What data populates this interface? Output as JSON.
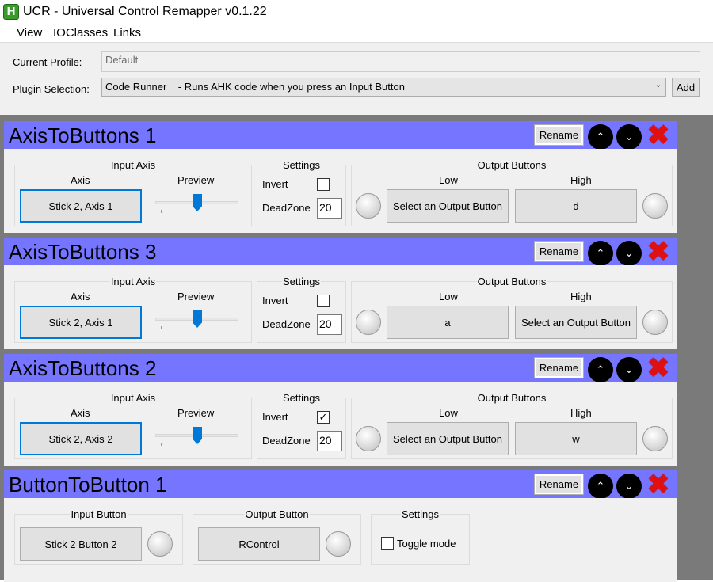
{
  "window": {
    "title": "UCR - Universal Control Remapper v0.1.22",
    "icon": "H"
  },
  "menu": [
    "View",
    "IOClasses",
    "Links"
  ],
  "profile": {
    "label": "Current Profile:",
    "value": "Default"
  },
  "plugin_selection": {
    "label": "Plugin Selection:",
    "value": "Code Runner    - Runs AHK code when you press an Input Button",
    "add_label": "Add"
  },
  "common": {
    "rename": "Rename",
    "input_axis": "Input Axis",
    "axis": "Axis",
    "preview": "Preview",
    "settings": "Settings",
    "invert": "Invert",
    "deadzone": "DeadZone",
    "output_buttons": "Output Buttons",
    "low": "Low",
    "high": "High",
    "input_button": "Input Button",
    "output_button": "Output Button",
    "toggle_mode": "Toggle mode"
  },
  "axis_panels": [
    {
      "title": "AxisToButtons 1",
      "axis": "Stick 2, Axis 1",
      "invert": false,
      "deadzone": "20",
      "low": "Select an Output Button",
      "high": "d",
      "preview": 0.5
    },
    {
      "title": "AxisToButtons 3",
      "axis": "Stick 2, Axis 1",
      "invert": false,
      "deadzone": "20",
      "low": "a",
      "high": "Select an Output Button",
      "preview": 0.5
    },
    {
      "title": "AxisToButtons 2",
      "axis": "Stick 2, Axis 2",
      "invert": true,
      "deadzone": "20",
      "low": "Select an Output Button",
      "high": "w",
      "preview": 0.5
    }
  ],
  "button_panel": {
    "title": "ButtonToButton 1",
    "input": "Stick 2 Button 2",
    "output": "RControl",
    "toggle": false
  },
  "colors": {
    "header": "#7575ff",
    "accent": "#0078d7",
    "background": "#7a7a7a"
  }
}
